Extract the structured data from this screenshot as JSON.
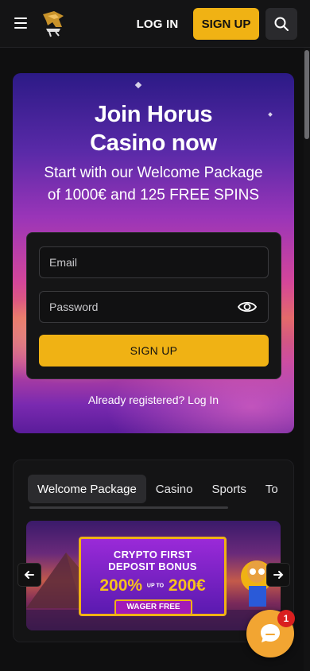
{
  "header": {
    "login_label": "LOG IN",
    "signup_label": "SIGN UP",
    "brand_color": "#f0b214"
  },
  "hero": {
    "title_line1": "Join Horus",
    "title_line2": "Casino now",
    "subtitle_line1": "Start with our Welcome Package",
    "subtitle_line2": "of 1000€ and 125 FREE SPINS",
    "form": {
      "email_placeholder": "Email",
      "password_placeholder": "Password",
      "signup_label": "SIGN UP"
    },
    "already_text": "Already registered?",
    "login_link": "Log In"
  },
  "promos": {
    "tabs": [
      {
        "label": "Welcome Package",
        "active": true
      },
      {
        "label": "Casino",
        "active": false
      },
      {
        "label": "Sports",
        "active": false
      },
      {
        "label": "To",
        "active": false
      }
    ],
    "banner": {
      "line1": "CRYPTO FIRST",
      "line2": "DEPOSIT BONUS",
      "percent": "200%",
      "upto": "UP TO",
      "amount": "200€",
      "wager": "WAGER FREE"
    }
  },
  "chat": {
    "badge_count": "1"
  }
}
